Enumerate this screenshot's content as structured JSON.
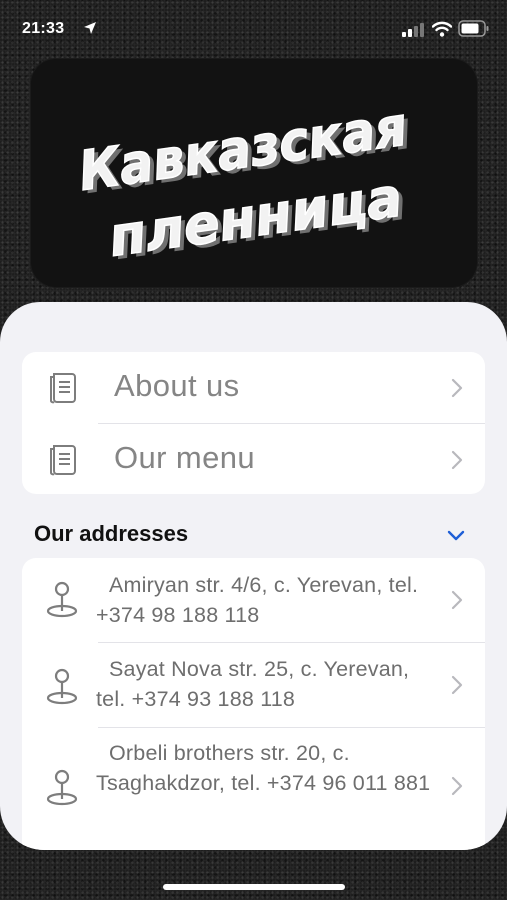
{
  "status_bar": {
    "time": "21:33",
    "icons": [
      "location-arrow-icon",
      "cellular-signal-icon",
      "wifi-icon",
      "battery-icon"
    ]
  },
  "logo": {
    "line1": "Кавказская",
    "line2": "пленница"
  },
  "menu": {
    "items": [
      {
        "label": "About us",
        "icon": "document-icon"
      },
      {
        "label": "Our menu",
        "icon": "document-icon"
      }
    ]
  },
  "addresses": {
    "title": "Our addresses",
    "items": [
      {
        "text": "Amiryan str. 4/6, c. Yerevan, tel. +374 98 188 118",
        "icon": "map-pin-icon"
      },
      {
        "text": "Sayat Nova str. 25, c. Yerevan, tel. +374 93 188 118",
        "icon": "map-pin-icon"
      },
      {
        "text": "Orbeli brothers str. 20, c. Tsaghakdzor, tel. +374 96 011 881",
        "icon": "map-pin-icon"
      }
    ]
  },
  "colors": {
    "sheet_background": "#f2f2f6",
    "card_background": "#ffffff",
    "accent": "#1f5fd6",
    "row_text": "#858585"
  }
}
